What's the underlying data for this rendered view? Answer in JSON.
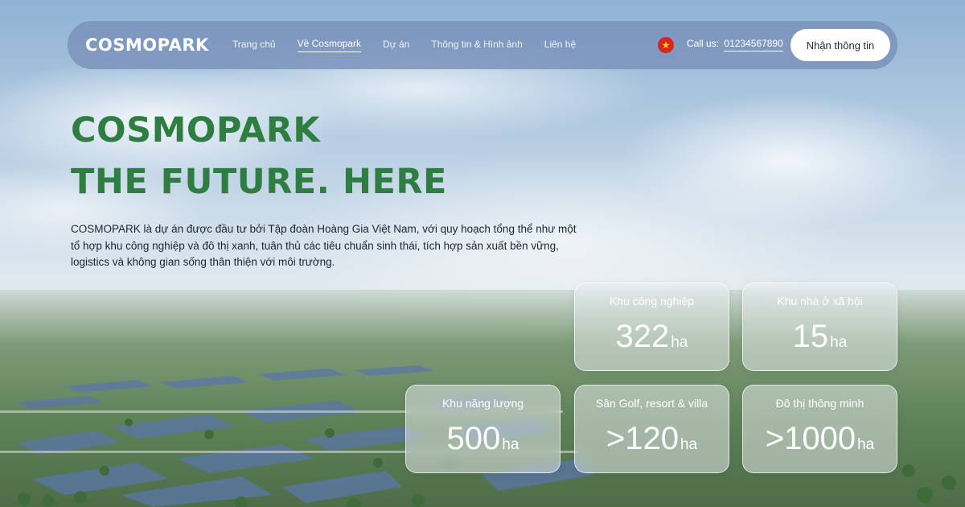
{
  "nav": {
    "logo": "COSMOPARK",
    "links": [
      "Trang chủ",
      "Về Cosmopark",
      "Dự án",
      "Thông tin & Hình ảnh",
      "Liên hệ"
    ],
    "active_index": 1,
    "flag_icon": "vietnam-flag-icon",
    "call_label": "Call us:",
    "phone": "01234567890",
    "cta": "Nhận thông tin"
  },
  "hero": {
    "title_line1": "COSMOPARK",
    "title_line2": "THE FUTURE. HERE",
    "description": "COSMOPARK là dự án được đầu tư bởi Tập đoàn Hoàng Gia Việt Nam, với quy hoạch tổng thể như một tổ hợp khu công nghiệp và đô thị xanh, tuân thủ các tiêu chuẩn sinh thái, tích hợp sản xuất bền vững, logistics và không gian sống thân thiện với môi trường."
  },
  "stats": [
    {
      "label": "Khu công nghiệp",
      "value": "322",
      "unit": "ha"
    },
    {
      "label": "Khu nhà ở xã hội",
      "value": "15",
      "unit": "ha"
    },
    {
      "label": "Khu năng lượng",
      "value": "500",
      "unit": "ha"
    },
    {
      "label": "Sân Golf, resort & villa",
      "value": ">120",
      "unit": "ha"
    },
    {
      "label": "Đô thị thông minh",
      "value": ">1000",
      "unit": "ha"
    }
  ],
  "colors": {
    "accent_green": "#2e7d41",
    "nav_bg": "#7a91ba",
    "flag_red": "#da251d"
  }
}
